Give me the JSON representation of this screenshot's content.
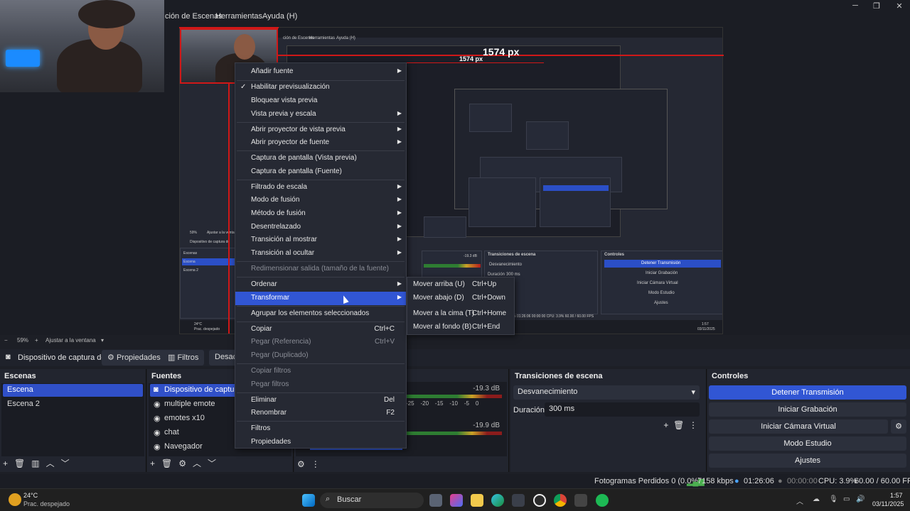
{
  "menubar": {
    "items": [
      "ción de Escenas",
      "Herramientas",
      "Ayuda (H)"
    ]
  },
  "preview": {
    "width_label": "1574 px",
    "nested_width_label": "1574 px",
    "nested_menu": [
      "ción de Escenas",
      "Herramientas",
      "Ayuda (H)"
    ]
  },
  "nested_ui": {
    "scenes_title": "Escenas",
    "scene1": "Escena",
    "scene2": "Escena 2",
    "source_title": "Dispositivo de captura de",
    "transitions_title": "Transiciones de escena",
    "transition_value": "Desvanecimiento",
    "duration_label": "Duración",
    "duration_value": "300 ms",
    "controls_title": "Controles",
    "stop_stream": "Detener Transmisión",
    "start_rec": "Iniciar Grabación",
    "virtual_cam": "Iniciar Cámara Virtual",
    "studio": "Modo Estudio",
    "settings": "Ajustes",
    "zoom": "59%",
    "fit": "Ajustar a la ventana",
    "status": "Fotogramas Perdidos 0 (0.0%)   7158 kbps   01:26:06   00:00:00   CPU: 3.9%   60.00 / 60.00 FPS",
    "weather_temp": "24°C",
    "weather_desc": "Prac. despejado",
    "clock": "1:57",
    "date": "03/11/2025",
    "meter_db": "-19.3 dB",
    "sub_items": [
      "Mover arriba (U)",
      "Mover abajo (D)",
      "Mover a la cima (T)",
      "Mover al fondo (B)"
    ],
    "sub_shortcuts": [
      "Ctrl+Up",
      "Ctrl+Down",
      "Ctrl+Home",
      "Ctrl+End"
    ]
  },
  "zoom": {
    "value": "59%",
    "minus": "−",
    "plus": "+",
    "fit": "Ajustar a la ventana"
  },
  "toolbar": {
    "source_name": "Dispositivo de captura de v",
    "properties": "Propiedades",
    "filters": "Filtros",
    "deactivate": "Desact"
  },
  "scenes": {
    "title": "Escenas",
    "items": [
      "Escena",
      "Escena 2"
    ]
  },
  "sources": {
    "title": "Fuentes",
    "items": [
      "Dispositivo de captura de",
      "multiple emote",
      "emotes x10",
      "chat",
      "Navegador"
    ]
  },
  "mixer": {
    "db1": "-19.3 dB",
    "db2": "-19.9 dB",
    "ticks": [
      "0",
      "-25",
      "-20",
      "-15",
      "-10",
      "-5",
      "0"
    ]
  },
  "transitions": {
    "title": "Transiciones de escena",
    "value": "Desvanecimiento",
    "duration_label": "Duración",
    "duration_value": "300 ms"
  },
  "controls": {
    "title": "Controles",
    "buttons": [
      "Detener Transmisión",
      "Iniciar Grabación",
      "Iniciar Cámara Virtual",
      "Modo Estudio",
      "Ajustes"
    ]
  },
  "status": {
    "dropped": "Fotogramas Perdidos 0 (0.0%)",
    "bitrate": "7158 kbps",
    "stream_time": "01:26:06",
    "rec_time": "00:00:00",
    "cpu": "CPU: 3.9%",
    "fps": "60.00 / 60.00 FPS"
  },
  "taskbar": {
    "temp": "24°C",
    "weather": "Prac. despejado",
    "search": "Buscar",
    "time": "1:57",
    "date": "03/11/2025"
  },
  "context_menu": {
    "items": [
      "Añadir fuente",
      "Habilitar previsualización",
      "Bloquear vista previa",
      "Vista previa y escala",
      "Abrir proyector de vista previa",
      "Abrir proyector de fuente",
      "Captura de pantalla (Vista previa)",
      "Captura de pantalla (Fuente)",
      "Filtrado de escala",
      "Modo de fusión",
      "Método de fusión",
      "Desentrelazado",
      "Transición al mostrar",
      "Transición al ocultar",
      "Redimensionar salida (tamaño de la fuente)",
      "Ordenar",
      "Transformar",
      "Agrupar los elementos seleccionados",
      "Copiar",
      "Pegar (Referencia)",
      "Pegar (Duplicado)",
      "Copiar filtros",
      "Pegar filtros",
      "Eliminar",
      "Renombrar",
      "Filtros",
      "Propiedades"
    ],
    "shortcuts": {
      "copy": "Ctrl+C",
      "paste_ref": "Ctrl+V",
      "delete": "Del",
      "rename": "F2"
    },
    "check_mark": "✓"
  },
  "submenu": {
    "items": [
      "Mover arriba (U)",
      "Mover abajo (D)",
      "Mover a la cima (T)",
      "Mover al fondo (B)"
    ],
    "shortcuts": [
      "Ctrl+Up",
      "Ctrl+Down",
      "Ctrl+Home",
      "Ctrl+End"
    ]
  },
  "colors": {
    "accent": "#3156d4",
    "panel": "#22252f",
    "background": "#1b1d24",
    "selection_red": "#d01818"
  }
}
